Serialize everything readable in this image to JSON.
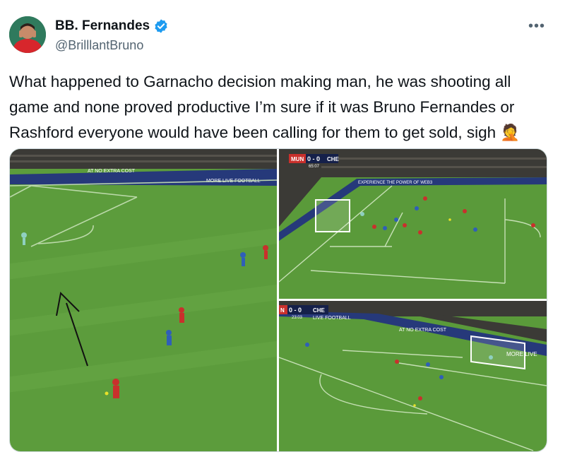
{
  "author": {
    "display_name": "BB. Fernandes",
    "handle": "@BrilllantBruno",
    "verified": true,
    "avatar_icon": "avatar-photo"
  },
  "menu_icon": "more-options-icon",
  "tweet": {
    "text": "What happened to Garnacho decision making man, he was shooting all game and none proved productive I’m sure if it was Bruno Fernandes or Rashford everyone would have been calling for them to get sold, sigh 🤦"
  },
  "media": {
    "image1": {
      "board_text_1": "AT NO EXTRA COST",
      "board_text_2": "MORE LIVE FOOTBALL"
    },
    "image2": {
      "home": "MUN",
      "score": "0 - 0",
      "away": "CHE",
      "clock": "65:07",
      "board_text": "EXPERIENCE THE POWER OF WEB3"
    },
    "image3": {
      "home": "N",
      "score": "0 - 0",
      "away": "CHE",
      "clock": "23:03",
      "board_text_1": "LIVE FOOTBALL",
      "board_text_2": "AT NO EXTRA COST",
      "board_text_3": "MORE LIVE"
    }
  },
  "colors": {
    "pitch": "#5a9a3a",
    "stands": "#3b3a36",
    "board": "#26397a",
    "verified": "#1d9bf0"
  }
}
